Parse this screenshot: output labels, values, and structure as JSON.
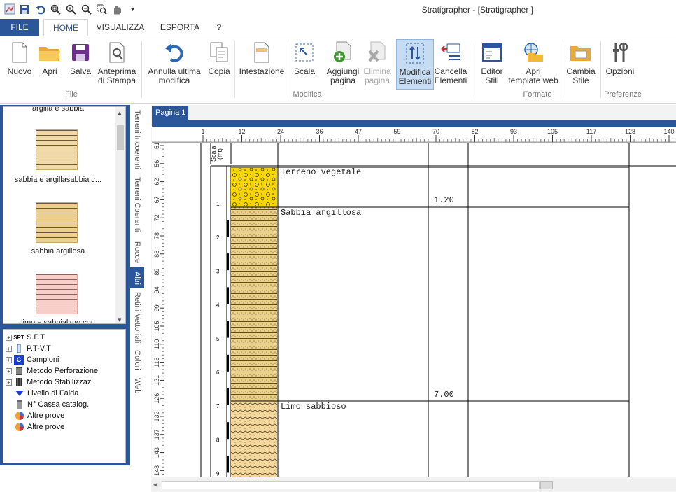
{
  "window": {
    "title": "Stratigrapher - [Stratigrapher ]"
  },
  "quick_access": [
    {
      "icon": "app-icon"
    },
    {
      "icon": "save-icon"
    },
    {
      "icon": "undo-icon"
    },
    {
      "icon": "zoom-fit-icon"
    },
    {
      "icon": "zoom-in-icon"
    },
    {
      "icon": "zoom-out-icon"
    },
    {
      "icon": "zoom-window-icon"
    },
    {
      "icon": "pan-icon"
    },
    {
      "icon": "customize-icon"
    }
  ],
  "tabs": [
    {
      "label": "FILE"
    },
    {
      "label": "HOME"
    },
    {
      "label": "VISUALIZZA"
    },
    {
      "label": "ESPORTA"
    },
    {
      "label": "?"
    }
  ],
  "ribbon": {
    "buttons": [
      {
        "l1": "Nuovo",
        "l2": "",
        "icon": "new-doc-icon"
      },
      {
        "l1": "Apri",
        "l2": "",
        "icon": "folder-icon"
      },
      {
        "l1": "Salva",
        "l2": "",
        "icon": "save-icon"
      },
      {
        "l1": "Anteprima",
        "l2": "di Stampa",
        "icon": "print-preview-icon"
      },
      {
        "l1": "Annulla ultima",
        "l2": "modifica",
        "icon": "undo-icon"
      },
      {
        "l1": "Copia",
        "l2": "",
        "icon": "copy-icon"
      },
      {
        "l1": "Intestazione",
        "l2": "",
        "icon": "header-icon"
      },
      {
        "l1": "Scala",
        "l2": "",
        "icon": "scale-icon"
      },
      {
        "l1": "Aggiungi",
        "l2": "pagina",
        "icon": "add-page-icon"
      },
      {
        "l1": "Elimina",
        "l2": "pagina",
        "icon": "delete-page-icon"
      },
      {
        "l1": "Modifica",
        "l2": "Elementi",
        "icon": "edit-elements-icon"
      },
      {
        "l1": "Cancella",
        "l2": "Elementi",
        "icon": "delete-elements-icon"
      },
      {
        "l1": "Editor",
        "l2": "Stili",
        "icon": "style-editor-icon"
      },
      {
        "l1": "Apri",
        "l2": "template web",
        "icon": "web-template-icon"
      },
      {
        "l1": "Cambia",
        "l2": "Stile",
        "icon": "change-style-icon"
      },
      {
        "l1": "Opzioni",
        "l2": "",
        "icon": "options-icon"
      }
    ],
    "groups": [
      {
        "label": "File"
      },
      {
        "label": "Modifica"
      },
      {
        "label": "Formato"
      },
      {
        "label": "Preferenze"
      }
    ]
  },
  "palette": {
    "items": [
      {
        "label": "argilla e sabbia",
        "color": "#f5e6c8"
      },
      {
        "label": "sabbia e argillasabbia c...",
        "color": "#f1d9a6"
      },
      {
        "label": "sabbia argillosa",
        "color": "#eccf8e"
      },
      {
        "label": "limo e sabbialimo con",
        "color": "#f8cfc8"
      }
    ]
  },
  "side_tabs": [
    {
      "label": "Terreni Incoerenti"
    },
    {
      "label": "Terreni Coerenti"
    },
    {
      "label": "Rocce"
    },
    {
      "label": "Altri"
    },
    {
      "label": "Retini Vettoriali"
    },
    {
      "label": "Colori"
    },
    {
      "label": "Web"
    }
  ],
  "tree": [
    {
      "label": "S.P.T",
      "icon": "spt-icon",
      "expand": "+"
    },
    {
      "label": "P.T-V.T",
      "icon": "ptvt-icon",
      "expand": "+"
    },
    {
      "label": "Campioni",
      "icon": "samples-icon",
      "expand": "+"
    },
    {
      "label": "Metodo Perforazione",
      "icon": "drilling-icon",
      "expand": "+"
    },
    {
      "label": "Metodo Stabilizzaz.",
      "icon": "stabilization-icon",
      "expand": "+"
    },
    {
      "label": "Livello di Falda",
      "icon": "water-level-icon",
      "expand": ""
    },
    {
      "label": "N° Cassa catalog.",
      "icon": "box-icon",
      "expand": ""
    },
    {
      "label": "Altre prove",
      "icon": "pie-icon",
      "expand": ""
    },
    {
      "label": "Altre prove",
      "icon": "pie-icon",
      "expand": ""
    }
  ],
  "page_tab": {
    "label": "Pagina 1"
  },
  "hruler": [
    "1",
    "12",
    "24",
    "36",
    "47",
    "59",
    "70",
    "82",
    "93",
    "105",
    "117",
    "128",
    "140"
  ],
  "vruler": [
    "51",
    "56",
    "62",
    "67",
    "72",
    "78",
    "83",
    "89",
    "94",
    "99",
    "105",
    "110",
    "116",
    "121",
    "126",
    "132",
    "137",
    "143",
    "148"
  ],
  "log": {
    "scale_header": "Scala (mt)",
    "depth_ticks": [
      "1",
      "2",
      "3",
      "4",
      "5",
      "6",
      "7",
      "8",
      "9"
    ],
    "layers": [
      {
        "name": "Terreno vegetale",
        "depth": "1.20",
        "color": "#f7d600"
      },
      {
        "name": "Sabbia argillosa",
        "depth": "7.00",
        "color": "#ecd08e"
      },
      {
        "name": "Limo sabbioso",
        "depth": "",
        "color": "#f3d79c"
      }
    ]
  },
  "colors": {
    "accent": "#2b579a",
    "selected": "#c5dcf2"
  }
}
